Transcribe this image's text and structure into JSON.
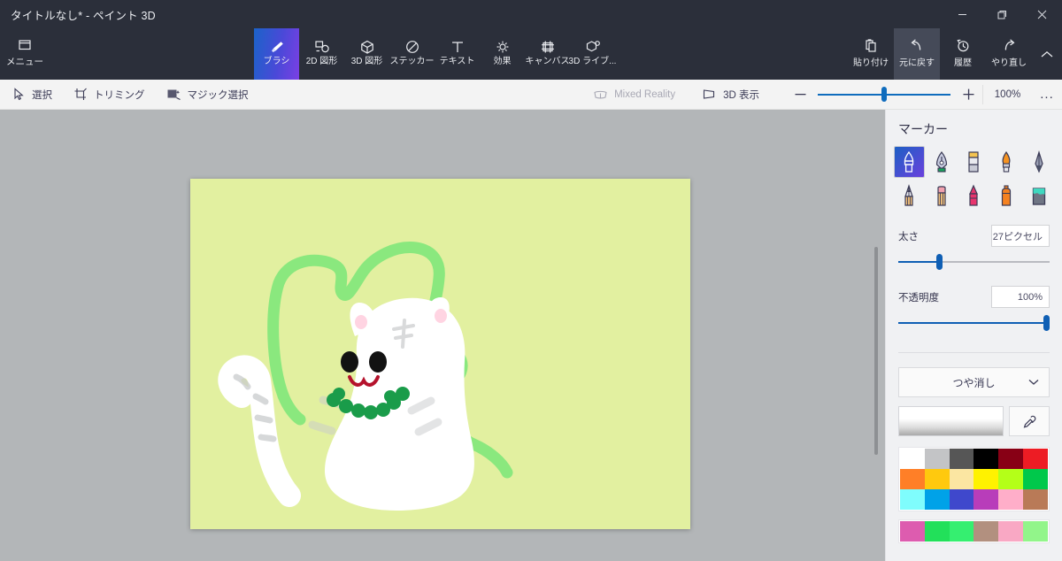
{
  "window": {
    "title": "タイトルなし* - ペイント 3D",
    "controls": [
      {
        "name": "minimize",
        "glyph": "minimize-icon"
      },
      {
        "name": "restore",
        "glyph": "restore-icon"
      },
      {
        "name": "close",
        "glyph": "close-icon"
      }
    ]
  },
  "ribbon": {
    "menu_label": "メニュー",
    "tabs": [
      {
        "label": "ブラシ",
        "icon": "brush-icon",
        "active": true
      },
      {
        "label": "2D 図形",
        "icon": "shapes-2d-icon",
        "active": false
      },
      {
        "label": "3D 図形",
        "icon": "shapes-3d-icon",
        "active": false
      },
      {
        "label": "ステッカー",
        "icon": "sticker-icon",
        "active": false
      },
      {
        "label": "テキスト",
        "icon": "text-icon",
        "active": false
      },
      {
        "label": "効果",
        "icon": "effects-icon",
        "active": false
      },
      {
        "label": "キャンバス",
        "icon": "canvas-icon",
        "active": false
      },
      {
        "label": "3D ライブ...",
        "icon": "3d-library-icon",
        "active": false
      }
    ],
    "right_buttons": [
      {
        "label": "貼り付け",
        "icon": "paste-icon",
        "selected": false
      },
      {
        "label": "元に戻す",
        "icon": "undo-icon",
        "selected": true
      },
      {
        "label": "履歴",
        "icon": "history-icon",
        "selected": false
      },
      {
        "label": "やり直し",
        "icon": "redo-icon",
        "selected": false
      }
    ],
    "collapse_icon": "chevron-up-icon"
  },
  "subtoolbar": {
    "left_buttons": [
      {
        "label": "選択",
        "icon": "cursor-select-icon",
        "disabled": false
      },
      {
        "label": "トリミング",
        "icon": "crop-icon",
        "disabled": false
      },
      {
        "label": "マジック選択",
        "icon": "magic-select-icon",
        "disabled": false
      }
    ],
    "mixed_reality": {
      "label": "Mixed Reality",
      "icon": "mixed-reality-icon",
      "disabled": true
    },
    "view_3d": {
      "label": "3D 表示",
      "icon": "view-3d-icon",
      "disabled": false
    },
    "zoom": {
      "minus_icon": "minus-icon",
      "plus_icon": "plus-icon",
      "value": "100%",
      "slider_position_percent": 50
    },
    "more_icon": "ellipsis-icon",
    "more_label": "..."
  },
  "panel": {
    "title": "マーカー",
    "brushes": [
      {
        "name": "marker-brush",
        "active": true
      },
      {
        "name": "calligraphy-pen-brush",
        "active": false
      },
      {
        "name": "oil-brush",
        "active": false
      },
      {
        "name": "watercolor-brush",
        "active": false
      },
      {
        "name": "pixel-pen-brush",
        "active": false
      },
      {
        "name": "pencil-brush",
        "active": false
      },
      {
        "name": "eraser-brush",
        "active": false
      },
      {
        "name": "crayon-brush",
        "active": false
      },
      {
        "name": "spray-can-brush",
        "active": false
      },
      {
        "name": "fill-bucket-brush",
        "active": false
      }
    ],
    "thickness": {
      "label": "太さ",
      "value": "27ピクセル",
      "slider_percent": 27
    },
    "opacity": {
      "label": "不透明度",
      "value": "100%",
      "slider_percent": 100
    },
    "material": {
      "value": "つや消し",
      "chevron_icon": "chevron-down-icon"
    },
    "current_color_name": "current-color-swatch",
    "eyedropper_icon": "eyedropper-icon",
    "palette": [
      [
        "#ffffff",
        "#c3c4c6",
        "#565656",
        "#000000",
        "#880015",
        "#ed1c24"
      ],
      [
        "#ff7f27",
        "#ffc90e",
        "#fbe6a2",
        "#fff200",
        "#b4ff18",
        "#00c84b"
      ],
      [
        "#7ffdfd",
        "#00a2e8",
        "#3f48cc",
        "#b83dba",
        "#ffaec9",
        "#b97a57"
      ]
    ],
    "recent_colors": [
      "#dd5caf",
      "#22e05a",
      "#35ef70",
      "#b2907f",
      "#f9a8c4",
      "#92f58a"
    ]
  },
  "canvas": {
    "background_color": "#e2f0a0",
    "workspace_color": "#b3b6b8",
    "artwork_name": "white-cat-drawing",
    "artwork_colors": {
      "squiggle": "#8ae87e",
      "cat_body": "#ffffff",
      "ear_inner": "#ffd4e2",
      "eye": "#121212",
      "mouth": "#b5122c",
      "necklace": "#1a9c4a",
      "stripe": "#c9cbcd"
    }
  }
}
